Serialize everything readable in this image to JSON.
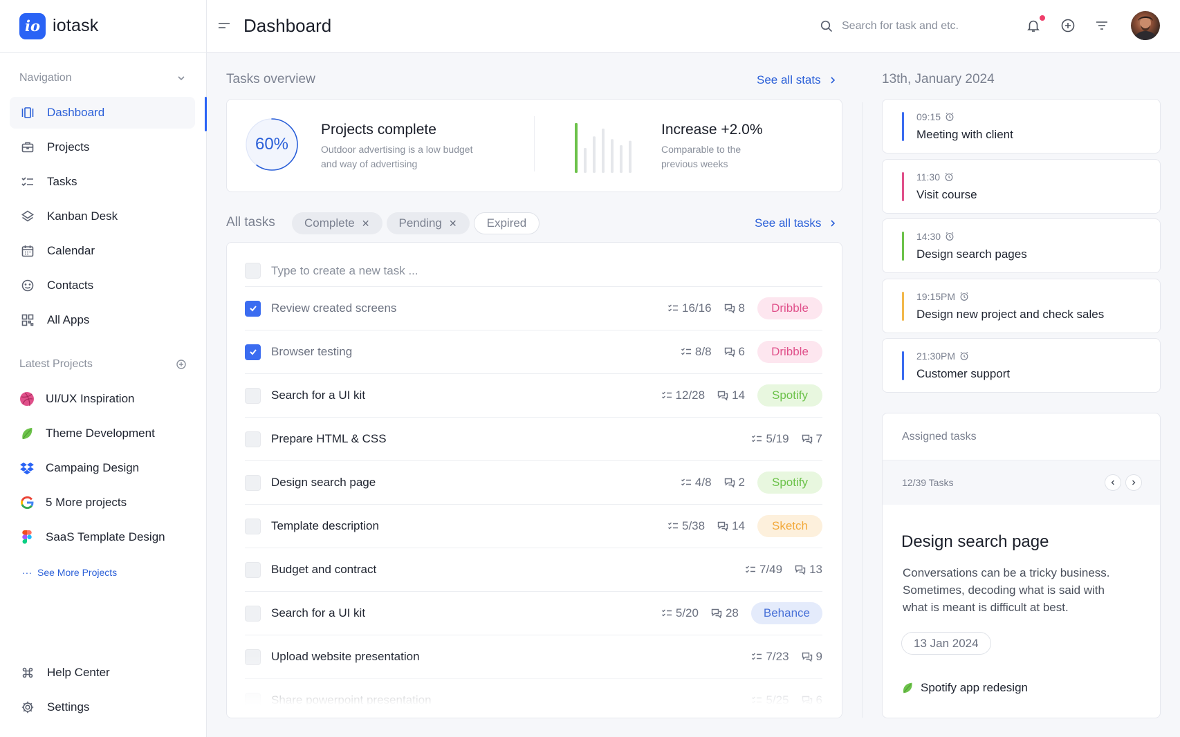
{
  "brand": {
    "logo_text": "io",
    "name": "iotask"
  },
  "sidebar": {
    "nav_heading": "Navigation",
    "items": [
      {
        "label": "Dashboard",
        "icon": "dashboard-icon",
        "active": true
      },
      {
        "label": "Projects",
        "icon": "briefcase-icon"
      },
      {
        "label": "Tasks",
        "icon": "checklist-icon"
      },
      {
        "label": "Kanban Desk",
        "icon": "layers-icon"
      },
      {
        "label": "Calendar",
        "icon": "calendar-icon"
      },
      {
        "label": "Contacts",
        "icon": "contacts-icon"
      },
      {
        "label": "All Apps",
        "icon": "apps-grid-icon"
      }
    ],
    "projects_heading": "Latest Projects",
    "projects": [
      {
        "label": "UI/UX Inspiration",
        "icon": "dribbble-icon"
      },
      {
        "label": "Theme Development",
        "icon": "leaf-icon"
      },
      {
        "label": "Campaing Design",
        "icon": "dropbox-icon"
      },
      {
        "label": "5 More projects",
        "icon": "google-icon"
      },
      {
        "label": "SaaS Template Design",
        "icon": "figma-icon"
      }
    ],
    "see_more": "See More Projects",
    "see_more_glyph": "···",
    "bottom": [
      {
        "label": "Help Center",
        "icon": "command-icon"
      },
      {
        "label": "Settings",
        "icon": "gear-icon"
      }
    ]
  },
  "header": {
    "title": "Dashboard",
    "search_placeholder": "Search for task and etc."
  },
  "overview": {
    "heading": "Tasks overview",
    "see_all": "See all stats",
    "progress_percent": 60,
    "progress_label": "60%",
    "complete_title": "Projects complete",
    "complete_sub_1": "Outdoor advertising is a low budget",
    "complete_sub_2": "and way of advertising",
    "increase_title": "Increase +2.0%",
    "increase_sub_1": "Comparable to the",
    "increase_sub_2": "previous weeks",
    "bar_levels": [
      0.9,
      0.45,
      0.66,
      0.8,
      0.61,
      0.5,
      0.58
    ]
  },
  "tasks": {
    "heading": "All tasks",
    "filters": [
      {
        "label": "Complete",
        "removable": true,
        "remove_glyph": "✕"
      },
      {
        "label": "Pending",
        "removable": true,
        "remove_glyph": "✕"
      },
      {
        "label": "Expired",
        "removable": false
      }
    ],
    "see_all": "See all tasks",
    "new_placeholder": "Type to create a new task ...",
    "rows": [
      {
        "name": "Review created screens",
        "done": true,
        "subtasks": "16/16",
        "comments": "8",
        "tag": "Dribble"
      },
      {
        "name": "Browser testing",
        "done": true,
        "subtasks": "8/8",
        "comments": "6",
        "tag": "Dribble"
      },
      {
        "name": "Search for a UI kit",
        "done": false,
        "subtasks": "12/28",
        "comments": "14",
        "tag": "Spotify"
      },
      {
        "name": "Prepare HTML & CSS",
        "done": false,
        "subtasks": "5/19",
        "comments": "7",
        "tag": ""
      },
      {
        "name": "Design search page",
        "done": false,
        "subtasks": "4/8",
        "comments": "2",
        "tag": "Spotify"
      },
      {
        "name": "Template description",
        "done": false,
        "subtasks": "5/38",
        "comments": "14",
        "tag": "Sketch"
      },
      {
        "name": "Budget and contract",
        "done": false,
        "subtasks": "7/49",
        "comments": "13",
        "tag": ""
      },
      {
        "name": "Search for a UI kit",
        "done": false,
        "subtasks": "5/20",
        "comments": "28",
        "tag": "Behance"
      },
      {
        "name": "Upload website presentation",
        "done": false,
        "subtasks": "7/23",
        "comments": "9",
        "tag": ""
      },
      {
        "name": "Share powerpoint presentation",
        "done": false,
        "subtasks": "5/25",
        "comments": "6",
        "tag": ""
      }
    ],
    "tag_colors": {
      "Dribble": {
        "bg": "#fde6ef",
        "fg": "#e0508a"
      },
      "Spotify": {
        "bg": "#e8f7df",
        "fg": "#6cc24a"
      },
      "Sketch": {
        "bg": "#fdf0dc",
        "fg": "#f2a93b"
      },
      "Behance": {
        "bg": "#e4ebfb",
        "fg": "#4a72d8"
      }
    }
  },
  "schedule": {
    "date": "13th, January 2024",
    "events": [
      {
        "time": "09:15",
        "title": "Meeting with client",
        "color": "#3b6cf0"
      },
      {
        "time": "11:30",
        "title": "Visit course",
        "color": "#e0508a"
      },
      {
        "time": "14:30",
        "title": "Design search pages",
        "color": "#6cc24a"
      },
      {
        "time": "19:15PM",
        "title": "Design new project and check sales",
        "color": "#f2b84b"
      },
      {
        "time": "21:30PM",
        "title": "Customer support",
        "color": "#3b6cf0"
      }
    ]
  },
  "assigned": {
    "heading": "Assigned tasks",
    "count": "12/39 Tasks",
    "title": "Design search page",
    "description": "Conversations can be a tricky business. Sometimes, decoding what is said with what is meant is difficult at best.",
    "date": "13 Jan 2024",
    "project": "Spotify app redesign"
  },
  "colors": {
    "accent": "#2a63f5",
    "link": "#2a5fd8",
    "progress_bar": "#6cc24a"
  }
}
